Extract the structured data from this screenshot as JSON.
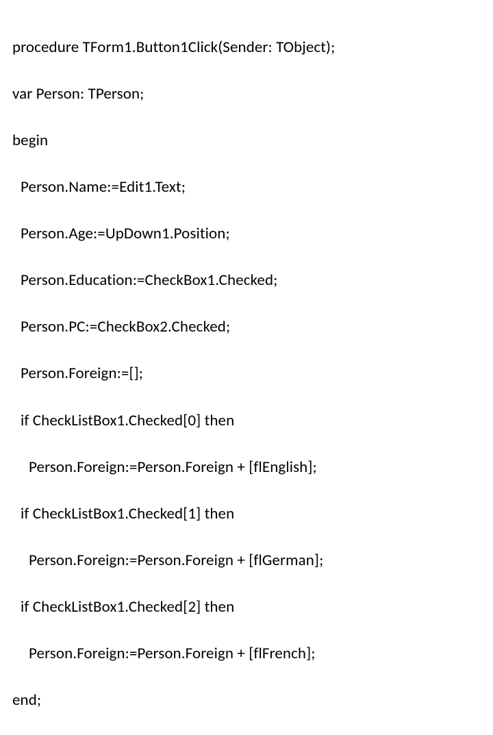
{
  "code": {
    "l0": "procedure TForm1.Button1Click(Sender: TObject);",
    "l1": "var Person: TPerson;",
    "l2": "begin",
    "l3": "Person.Name:=Edit1.Text;",
    "l4": "Person.Age:=UpDown1.Position;",
    "l5": "Person.Education:=CheckBox1.Checked;",
    "l6": "Person.PC:=CheckBox2.Checked;",
    "l7": "Person.Foreign:=[];",
    "l8": "if CheckListBox1.Checked[0] then",
    "l9": "Person.Foreign:=Person.Foreign + [flEnglish];",
    "l10": "if CheckListBox1.Checked[1] then",
    "l11": "Person.Foreign:=Person.Foreign + [flGerman];",
    "l12": "if CheckListBox1.Checked[2] then",
    "l13": "Person.Foreign:=Person.Foreign + [flFrench];",
    "l14": "end;"
  }
}
